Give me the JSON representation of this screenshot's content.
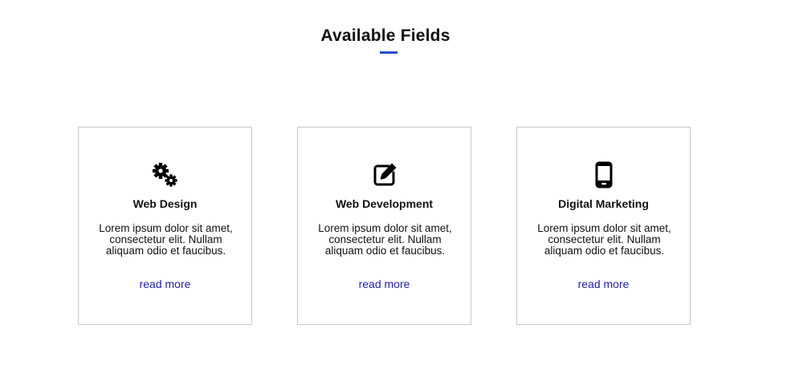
{
  "section": {
    "title": "Available Fields",
    "accent_color": "#1f4ecf"
  },
  "cards": [
    {
      "icon": "gears-icon",
      "title": "Web Design",
      "text": "Lorem ipsum dolor sit amet, consectetur elit. Nullam aliquam odio et faucibus.",
      "link": "read more"
    },
    {
      "icon": "edit-icon",
      "title": "Web Development",
      "text": "Lorem ipsum dolor sit amet, consectetur elit. Nullam aliquam odio et faucibus.",
      "link": "read more"
    },
    {
      "icon": "mobile-phone-icon",
      "title": "Digital Marketing",
      "text": "Lorem ipsum dolor sit amet, consectetur elit. Nullam aliquam odio et faucibus.",
      "link": "read more"
    }
  ],
  "link_color": "#2222a8"
}
